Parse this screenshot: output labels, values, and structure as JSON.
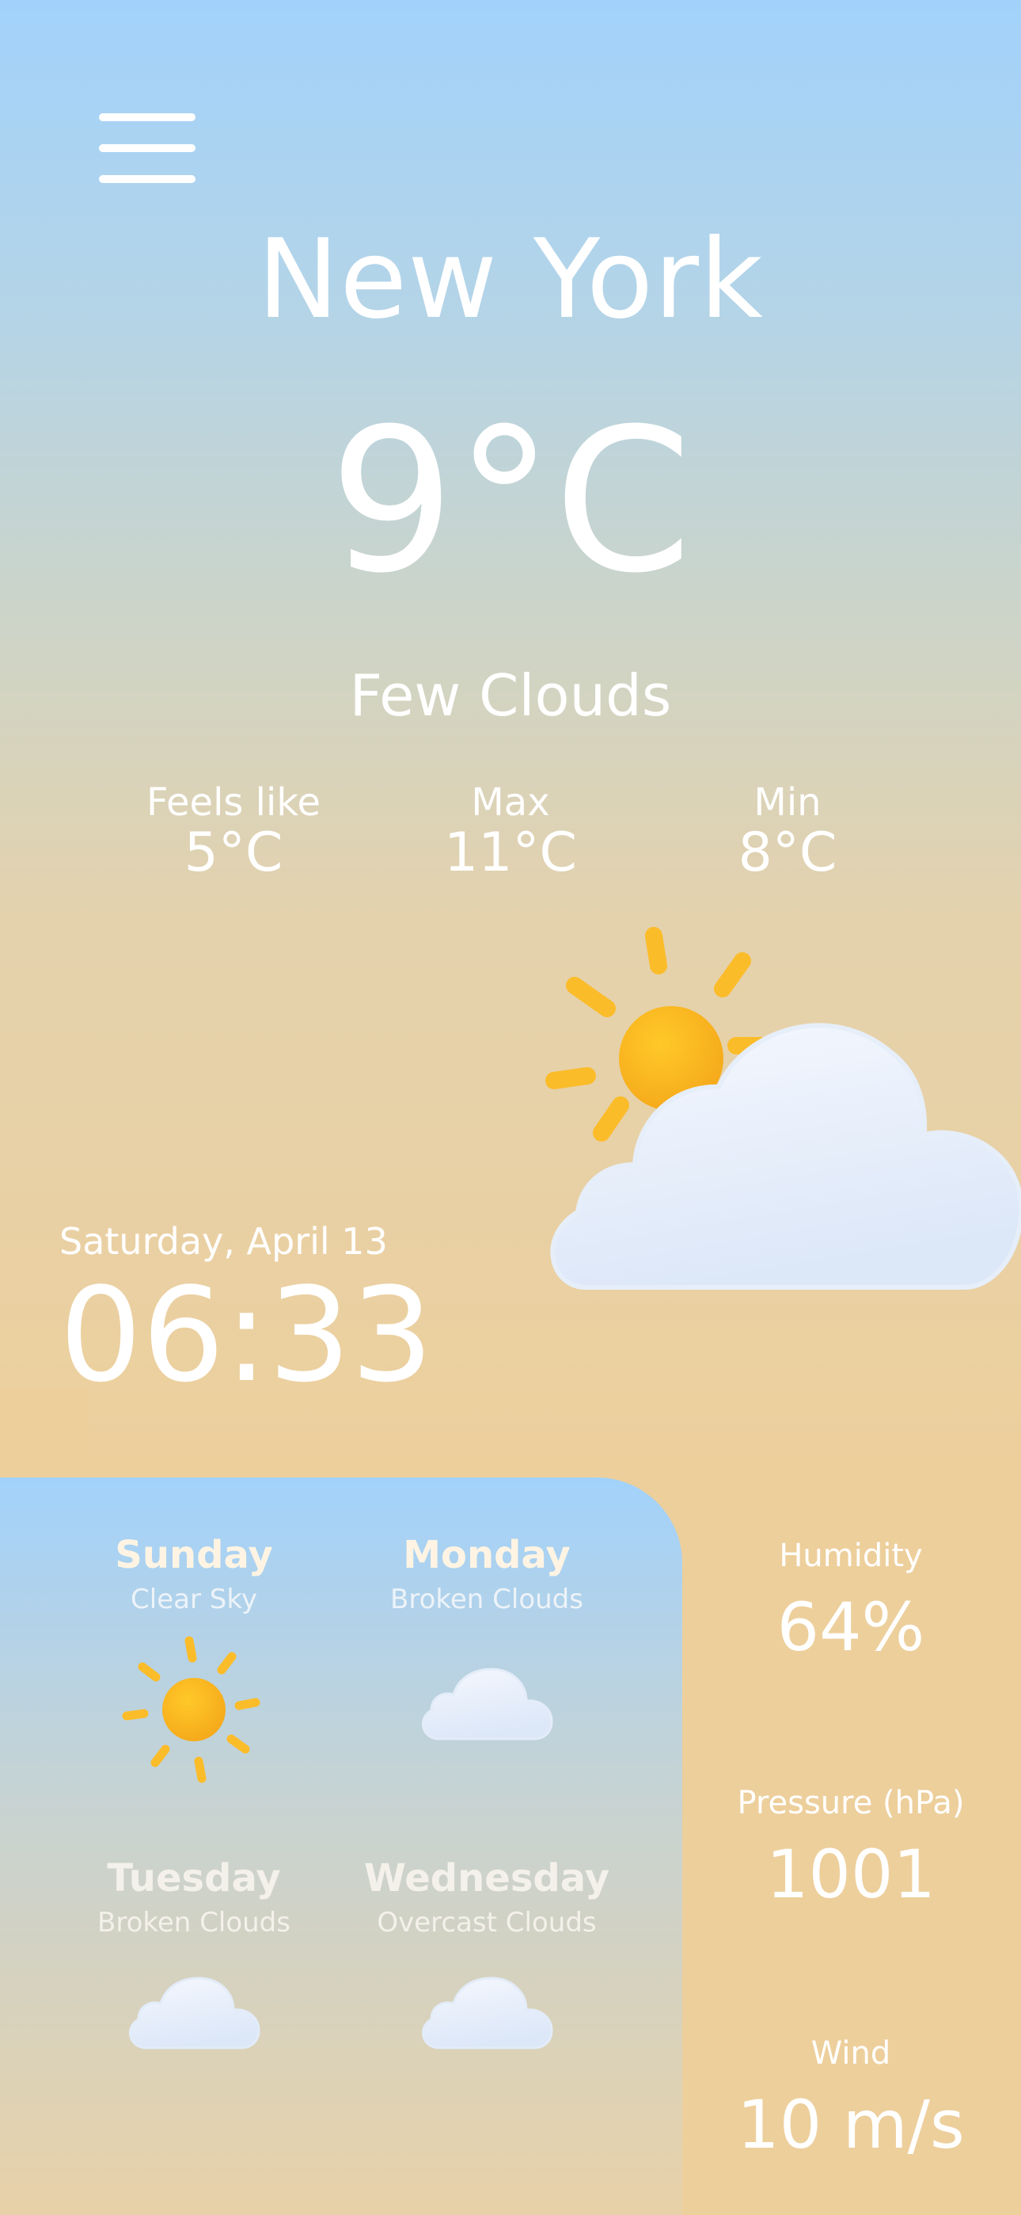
{
  "city": "New York",
  "temperature": "9°C",
  "condition": "Few Clouds",
  "stats": [
    {
      "label": "Feels like",
      "value": "5°C"
    },
    {
      "label": "Max",
      "value": "11°C"
    },
    {
      "label": "Min",
      "value": "8°C"
    }
  ],
  "current_icon": "partly-cloudy-icon",
  "date": "Saturday, April 13",
  "time": "06:33",
  "forecast": [
    {
      "day": "Sunday",
      "desc": "Clear Sky",
      "icon": "sun-icon",
      "name_color": "#fff4e3",
      "desc_color": "#edf3f8"
    },
    {
      "day": "Monday",
      "desc": "Broken Clouds",
      "icon": "cloud-icon",
      "name_color": "#fff4e3",
      "desc_color": "#edf3f8"
    },
    {
      "day": "Tuesday",
      "desc": "Broken Clouds",
      "icon": "cloud-icon",
      "name_color": "#f4f1ea",
      "desc_color": "#f4f1ea"
    },
    {
      "day": "Wednesday",
      "desc": "Overcast Clouds",
      "icon": "cloud-icon",
      "name_color": "#f4f1ea",
      "desc_color": "#f4f1ea"
    }
  ],
  "metrics": [
    {
      "label": "Humidity",
      "value": "64%"
    },
    {
      "label": "Pressure (hPa)",
      "value": "1001"
    },
    {
      "label": "Wind",
      "value": "10 m/s"
    }
  ],
  "colors": {
    "sky_top": "#a2d2fb",
    "sand": "#edcf9c",
    "sun": "#fbbc2a",
    "cloud": "#f2f6fd"
  }
}
